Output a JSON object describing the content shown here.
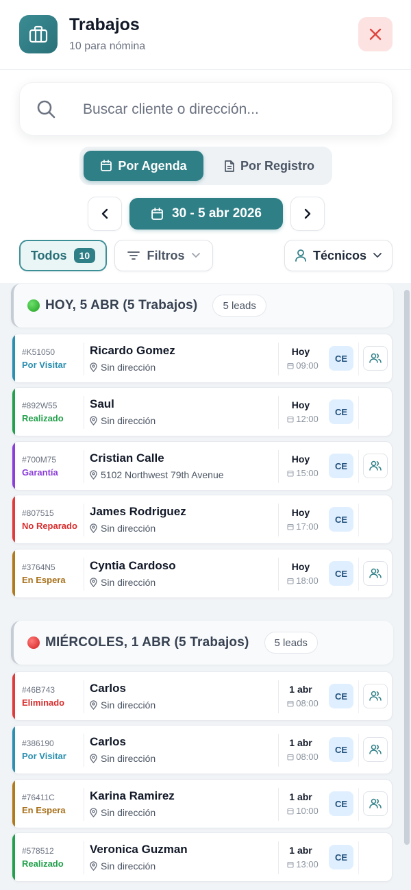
{
  "header": {
    "title": "Trabajos",
    "subtitle": "10 para nómina"
  },
  "search": {
    "placeholder": "Buscar cliente o dirección..."
  },
  "view_toggle": {
    "agenda_label": "Por Agenda",
    "registro_label": "Por Registro"
  },
  "date_range": {
    "label": "30 - 5 abr 2026"
  },
  "filters": {
    "todos_label": "Todos",
    "todos_count": "10",
    "filtros_label": "Filtros",
    "tecnicos_label": "Técnicos"
  },
  "colors": {
    "accent": "#2f7f87",
    "por_visitar": "#2a8fb0",
    "realizado": "#22a04b",
    "garantia": "#8b3fd9",
    "no_reparado": "#e03a3a",
    "en_espera": "#b07a1c",
    "eliminado": "#e03a3a"
  },
  "groups": [
    {
      "title": "HOY, 5 ABR (5 Trabajos)",
      "leads": "5 leads",
      "dot": "green",
      "jobs": [
        {
          "code": "#K51050",
          "status": "Por Visitar",
          "name": "Ricardo Gomez",
          "address": "Sin dirección",
          "day": "Hoy",
          "time": "09:00",
          "badge": "CE",
          "team": true
        },
        {
          "code": "#892W55",
          "status": "Realizado",
          "name": "Saul",
          "address": "Sin dirección",
          "day": "Hoy",
          "time": "12:00",
          "badge": "CE",
          "team": false
        },
        {
          "code": "#700M75",
          "status": "Garantía",
          "name": "Cristian Calle",
          "address": "5102 Northwest 79th Avenue",
          "day": "Hoy",
          "time": "15:00",
          "badge": "CE",
          "team": true
        },
        {
          "code": "#807515",
          "status": "No Reparado",
          "name": "James Rodriguez",
          "address": "Sin dirección",
          "day": "Hoy",
          "time": "17:00",
          "badge": "CE",
          "team": false
        },
        {
          "code": "#3764N5",
          "status": "En Espera",
          "name": "Cyntia Cardoso",
          "address": "Sin dirección",
          "day": "Hoy",
          "time": "18:00",
          "badge": "CE",
          "team": true
        }
      ]
    },
    {
      "title": "MIÉRCOLES, 1 ABR (5 Trabajos)",
      "leads": "5 leads",
      "dot": "red",
      "jobs": [
        {
          "code": "#46B743",
          "status": "Eliminado",
          "name": "Carlos",
          "address": "Sin dirección",
          "day": "1 abr",
          "time": "08:00",
          "badge": "CE",
          "team": true
        },
        {
          "code": "#386190",
          "status": "Por Visitar",
          "name": "Carlos",
          "address": "Sin dirección",
          "day": "1 abr",
          "time": "08:00",
          "badge": "CE",
          "team": true
        },
        {
          "code": "#76411C",
          "status": "En Espera",
          "name": "Karina Ramirez",
          "address": "Sin dirección",
          "day": "1 abr",
          "time": "10:00",
          "badge": "CE",
          "team": true
        },
        {
          "code": "#578512",
          "status": "Realizado",
          "name": "Veronica Guzman",
          "address": "Sin dirección",
          "day": "1 abr",
          "time": "13:00",
          "badge": "CE",
          "team": false
        }
      ]
    }
  ]
}
